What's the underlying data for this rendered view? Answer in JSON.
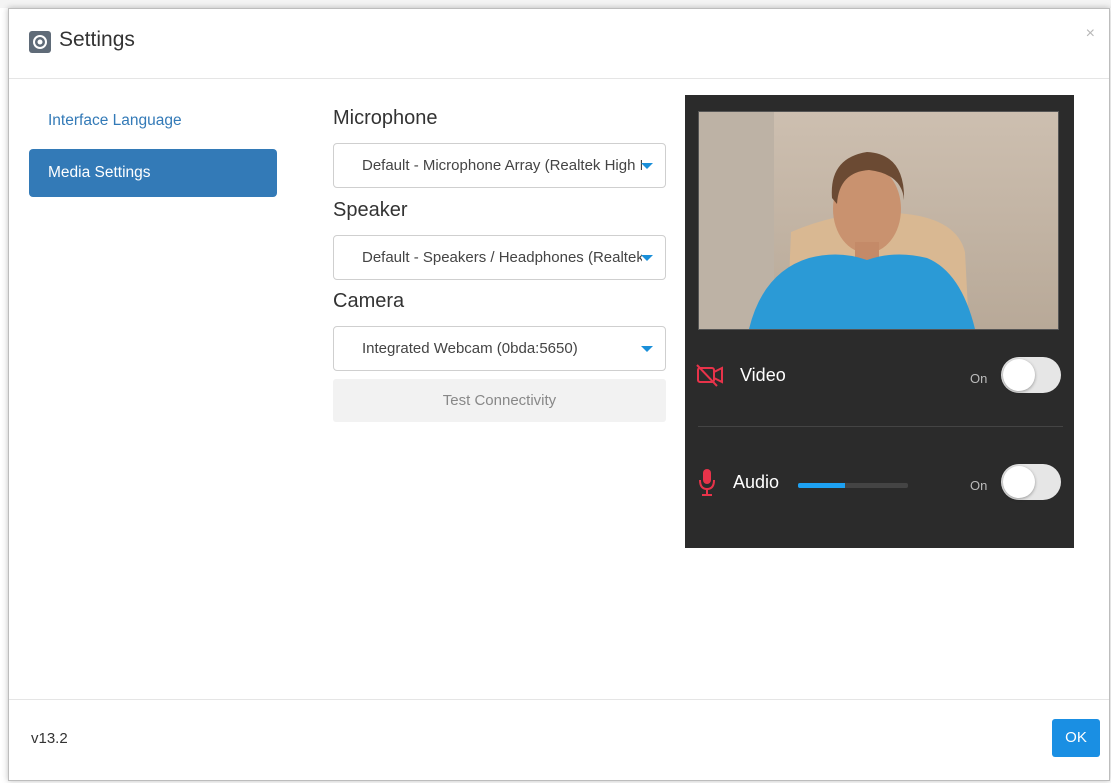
{
  "dialog": {
    "title": "Settings",
    "close_label": "×"
  },
  "nav": {
    "items": [
      {
        "label": "Interface Language",
        "active": false
      },
      {
        "label": "Media Settings",
        "active": true
      }
    ]
  },
  "media": {
    "microphone": {
      "label": "Microphone",
      "value": "Default - Microphone Array (Realtek High Definition Audio)"
    },
    "speaker": {
      "label": "Speaker",
      "value": "Default - Speakers / Headphones (Realtek High Definition Audio)"
    },
    "camera": {
      "label": "Camera",
      "value": "Integrated Webcam (0bda:5650)"
    },
    "test_label": "Test Connectivity"
  },
  "preview": {
    "video": {
      "label": "Video",
      "state": "On",
      "icon": "video-off-icon"
    },
    "audio": {
      "label": "Audio",
      "state": "On",
      "icon": "mic-icon",
      "level": 0.43
    },
    "accent_color": "#e8334a"
  },
  "footer": {
    "version": "v13.2",
    "ok_label": "OK"
  }
}
